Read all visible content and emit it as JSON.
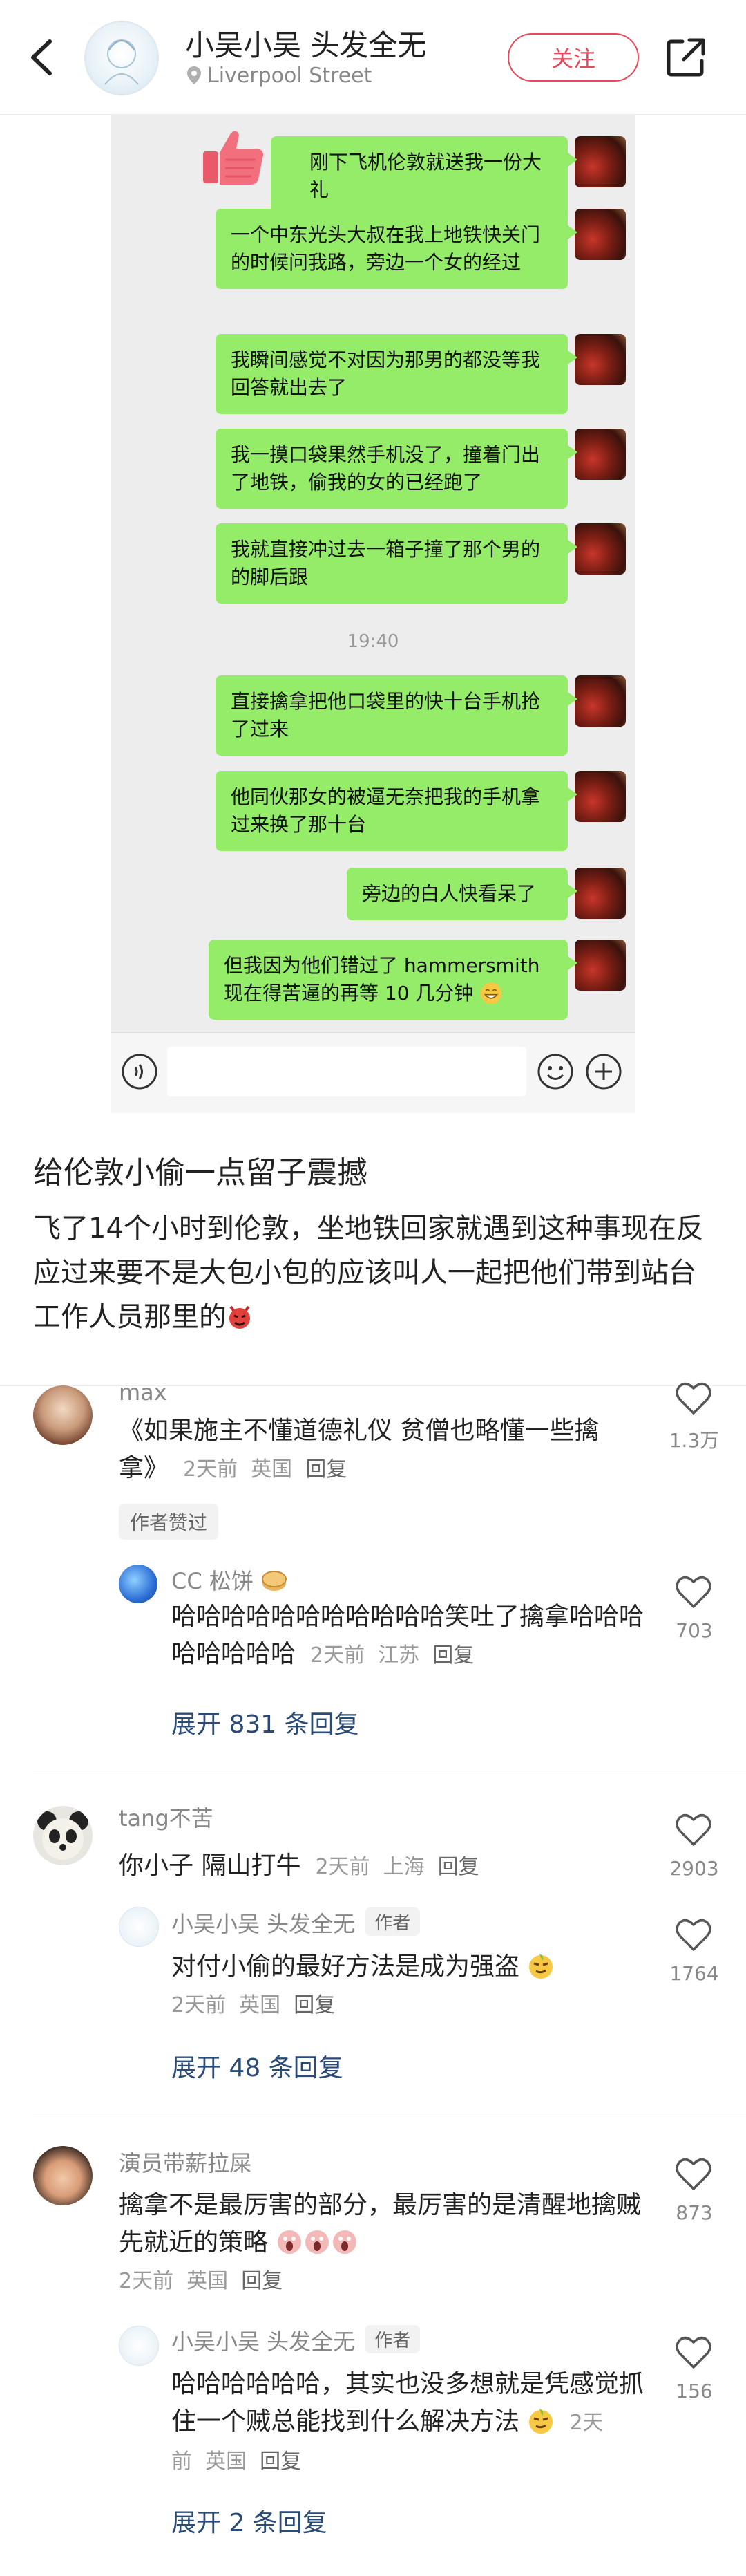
{
  "header": {
    "user_name": "小吴小吴 头发全无",
    "location": "Liverpool Street",
    "follow_label": "关注"
  },
  "chat": {
    "messages": [
      "刚下飞机伦敦就送我一份大礼",
      "一个中东光头大叔在我上地铁快关门的时候问我路，旁边一个女的经过",
      "我瞬间感觉不对因为那男的都没等我回答就出去了",
      "我一摸口袋果然手机没了，撞着门出了地铁，偷我的女的已经跑了",
      "我就直接冲过去一箱子撞了那个男的的脚后跟",
      "直接擒拿把他口袋里的快十台手机抢了过来",
      "他同伙那女的被逼无奈把我的手机拿过来换了那十台",
      "旁边的白人快看呆了",
      "但我因为他们错过了 hammersmith 现在得苦逼的再等 10 几分钟"
    ],
    "time": "19:40"
  },
  "post": {
    "title": "给伦敦小偷一点留子震撼",
    "body": "飞了14个小时到伦敦，坐地铁回家就遇到这种事现在反应过来要不是大包小包的应该叫人一起把他们带到站台工作人员那里的"
  },
  "comments": [
    {
      "user": "max",
      "text": "《如果施主不懂道德礼仪 贫僧也略懂一些擒拿》",
      "time": "2天前",
      "region": "英国",
      "reply": "回复",
      "likes": "1.3万",
      "liked_tag": "作者赞过",
      "sub": {
        "user": "CC 松饼",
        "text": "哈哈哈哈哈哈哈哈哈哈哈笑吐了擒拿哈哈哈哈哈哈哈哈",
        "time": "2天前",
        "region": "江苏",
        "reply": "回复",
        "likes": "703"
      },
      "expand": "展开 831 条回复"
    },
    {
      "user": "tang不苦",
      "text": "你小子 隔山打牛",
      "time": "2天前",
      "region": "上海",
      "reply": "回复",
      "likes": "2903",
      "sub": {
        "user": "小吴小吴 头发全无",
        "tag": "作者",
        "text": "对付小偷的最好方法是成为强盗",
        "time": "2天前",
        "region": "英国",
        "reply": "回复",
        "likes": "1764"
      },
      "expand": "展开 48 条回复"
    },
    {
      "user": "演员带薪拉屎",
      "text": "擒拿不是最厉害的部分，最厉害的是清醒地擒贼先就近的策略",
      "time": "2天前",
      "region": "英国",
      "reply": "回复",
      "likes": "873",
      "sub": {
        "user": "小吴小吴 头发全无",
        "tag": "作者",
        "text": "哈哈哈哈哈哈，其实也没多想就是凭感觉抓住一个贼总能找到什么解决方法",
        "time": "2天前",
        "region": "英国",
        "reply": "回复",
        "likes": "156"
      },
      "expand": "展开 2 条回复"
    }
  ]
}
